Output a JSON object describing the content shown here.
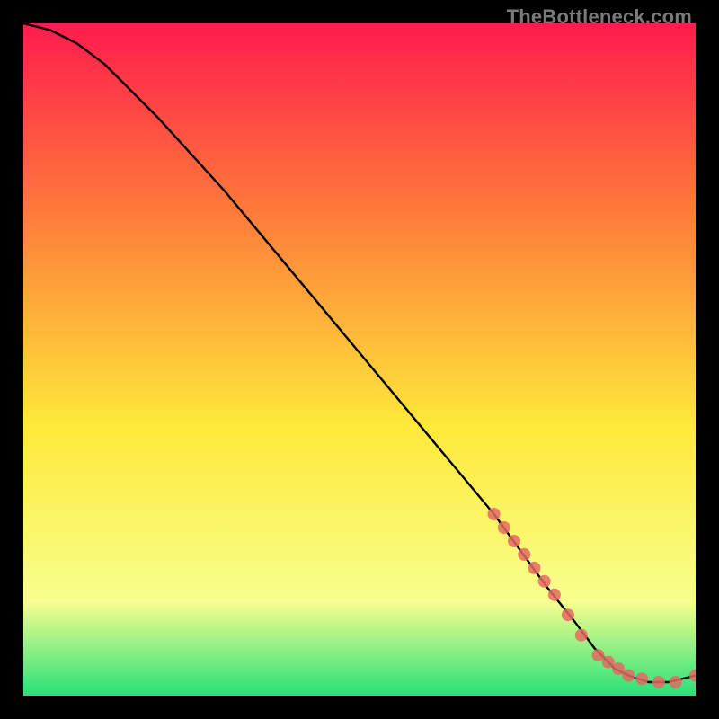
{
  "watermark": "TheBottleneck.com",
  "colors": {
    "background": "#000000",
    "gradient_top": "#ff1b4e",
    "gradient_mid1": "#ff7a3a",
    "gradient_mid2": "#ffe939",
    "gradient_mid3": "#f7ff8e",
    "gradient_bottom": "#26e07a",
    "curve": "#000000",
    "marker": "#e46a61"
  },
  "chart_data": {
    "type": "line",
    "title": "",
    "xlabel": "",
    "ylabel": "",
    "xlim": [
      0,
      100
    ],
    "ylim": [
      0,
      100
    ],
    "series": [
      {
        "name": "bottleneck-curve",
        "x": [
          0,
          4,
          8,
          12,
          16,
          20,
          30,
          40,
          50,
          60,
          70,
          78,
          82,
          85,
          88,
          90,
          93,
          96,
          100
        ],
        "y": [
          100,
          99,
          97,
          94,
          90,
          86,
          75,
          63,
          51,
          39,
          27,
          16,
          11,
          7,
          4,
          3,
          2,
          2,
          3
        ]
      }
    ],
    "markers": {
      "name": "highlighted-points",
      "x": [
        70,
        71.5,
        73,
        74.5,
        76,
        77.5,
        79,
        81,
        83,
        85.5,
        87,
        88.5,
        90,
        92,
        94.5,
        97,
        100
      ],
      "y": [
        27,
        25,
        23,
        21,
        19,
        17,
        15,
        12,
        9,
        6,
        5,
        4,
        3,
        2.5,
        2,
        2,
        3
      ]
    }
  }
}
